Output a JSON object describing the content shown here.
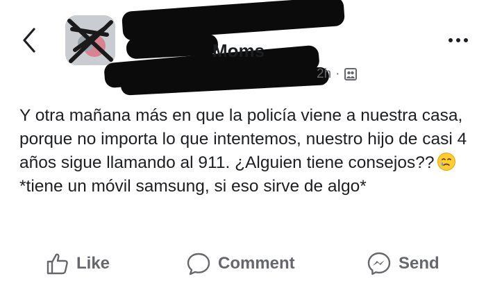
{
  "header": {
    "group_name_visible": "Moms",
    "timestamp": "2h",
    "separator": "·"
  },
  "post": {
    "line1": "Y otra mañana más en que la policía viene a nuestra casa, porque no importa lo que intentemos, nuestro hijo de casi 4 años sigue llamando al 911. ¿Alguien tiene consejos??",
    "line2": "*tiene un móvil samsung, si eso sirve de algo*",
    "emoji_name": "face-holding-back-tears"
  },
  "actions": {
    "like": "Like",
    "comment": "Comment",
    "send": "Send"
  },
  "colors": {
    "text": "#1c1e21",
    "secondary": "#65676b",
    "redaction": "#0b0b0b"
  }
}
